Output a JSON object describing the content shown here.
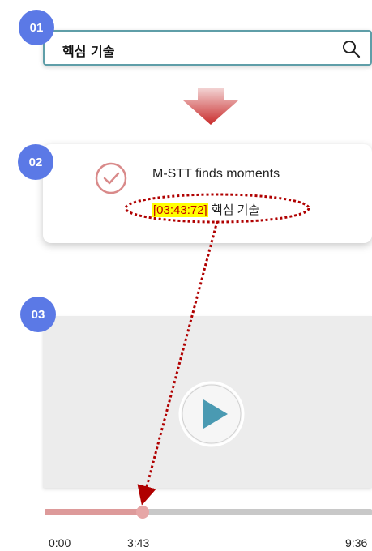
{
  "steps": {
    "one": "01",
    "two": "02",
    "three": "03"
  },
  "search": {
    "query": "핵심 기술",
    "icon": "search-icon"
  },
  "result_card": {
    "title": "M-STT finds moments",
    "timestamp": "[03:43:72]",
    "keyword": "핵심 기술",
    "icon": "check-circle-icon"
  },
  "player": {
    "play_icon": "play-icon",
    "start_time": "0:00",
    "current_time": "3:43",
    "end_time": "9:36",
    "progress_fraction": 0.3,
    "colors": {
      "played": "#dd9a9a",
      "track": "#c8c8c8",
      "play": "#4a9ab2"
    }
  },
  "colors": {
    "badge": "#5b79e6",
    "search_border": "#5f9ea8",
    "highlight": "#ffff00",
    "connector": "#b00000"
  }
}
